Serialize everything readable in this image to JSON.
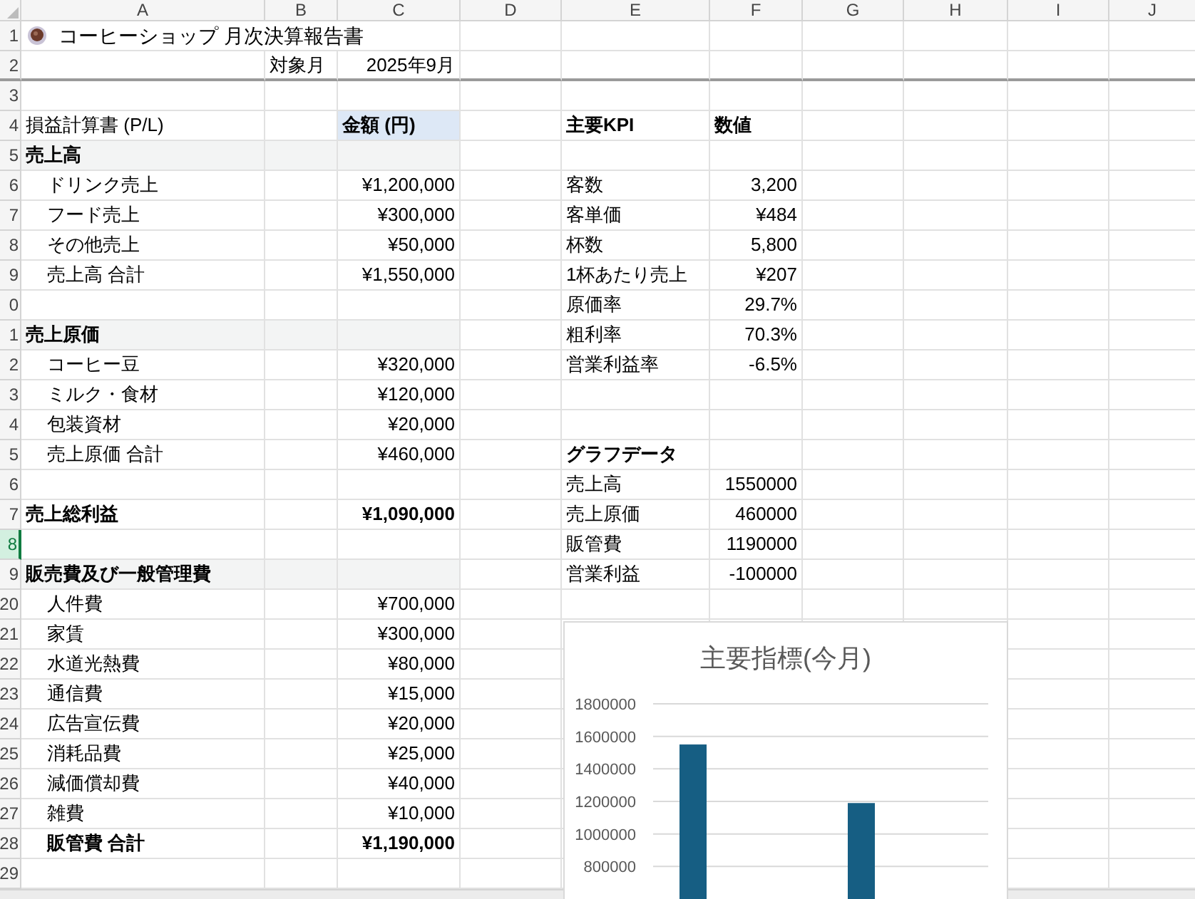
{
  "columns": [
    "A",
    "B",
    "C",
    "D",
    "E",
    "F",
    "G",
    "H",
    "I",
    "J"
  ],
  "rows": [
    {
      "number": "1",
      "selected": false,
      "section": false,
      "cells": {
        "a": {
          "text": "コーヒーショップ 月次決算報告書",
          "kind": "title",
          "bold": false,
          "highlighted": false
        }
      }
    },
    {
      "number": "2",
      "selected": false,
      "section": false,
      "cells": {
        "b": {
          "text": "対象月",
          "kind": "text",
          "bold": false,
          "highlighted": false
        },
        "c": {
          "text": "2025年9月",
          "kind": "number",
          "bold": false,
          "highlighted": false
        }
      }
    },
    {
      "number": "3",
      "selected": false,
      "section": false,
      "cells": {}
    },
    {
      "number": "4",
      "selected": false,
      "section": false,
      "cells": {
        "a": {
          "text": "損益計算書 (P/L)",
          "kind": "text",
          "bold": false,
          "highlighted": false
        },
        "c": {
          "text": "金額 (円)",
          "kind": "text",
          "bold": true,
          "highlighted": true
        },
        "e": {
          "text": "主要KPI",
          "kind": "text",
          "bold": true,
          "highlighted": false
        },
        "f": {
          "text": "数値",
          "kind": "text",
          "bold": true,
          "highlighted": false
        }
      }
    },
    {
      "number": "5",
      "selected": false,
      "section": true,
      "cells": {
        "a": {
          "text": "売上高",
          "kind": "text",
          "bold": true,
          "highlighted": false
        }
      }
    },
    {
      "number": "6",
      "selected": false,
      "section": false,
      "cells": {
        "a": {
          "text": "ドリンク売上",
          "kind": "indent",
          "bold": false,
          "highlighted": false
        },
        "c": {
          "text": "¥1,200,000",
          "kind": "number",
          "bold": false,
          "highlighted": false
        },
        "e": {
          "text": "客数",
          "kind": "text",
          "bold": false,
          "highlighted": false
        },
        "f": {
          "text": "3,200",
          "kind": "number",
          "bold": false,
          "highlighted": false
        }
      }
    },
    {
      "number": "7",
      "selected": false,
      "section": false,
      "cells": {
        "a": {
          "text": "フード売上",
          "kind": "indent",
          "bold": false,
          "highlighted": false
        },
        "c": {
          "text": "¥300,000",
          "kind": "number",
          "bold": false,
          "highlighted": false
        },
        "e": {
          "text": "客単価",
          "kind": "text",
          "bold": false,
          "highlighted": false
        },
        "f": {
          "text": "¥484",
          "kind": "number",
          "bold": false,
          "highlighted": false
        }
      }
    },
    {
      "number": "8",
      "selected": false,
      "section": false,
      "cells": {
        "a": {
          "text": "その他売上",
          "kind": "indent",
          "bold": false,
          "highlighted": false
        },
        "c": {
          "text": "¥50,000",
          "kind": "number",
          "bold": false,
          "highlighted": false
        },
        "e": {
          "text": "杯数",
          "kind": "text",
          "bold": false,
          "highlighted": false
        },
        "f": {
          "text": "5,800",
          "kind": "number",
          "bold": false,
          "highlighted": false
        }
      }
    },
    {
      "number": "9",
      "selected": false,
      "section": false,
      "cells": {
        "a": {
          "text": "売上高 合計",
          "kind": "indent",
          "bold": false,
          "highlighted": false
        },
        "c": {
          "text": "¥1,550,000",
          "kind": "number",
          "bold": false,
          "highlighted": false
        },
        "e": {
          "text": "1杯あたり売上",
          "kind": "text",
          "bold": false,
          "highlighted": false
        },
        "f": {
          "text": "¥207",
          "kind": "number",
          "bold": false,
          "highlighted": false
        }
      }
    },
    {
      "number": "0",
      "selected": false,
      "section": false,
      "cells": {
        "e": {
          "text": "原価率",
          "kind": "text",
          "bold": false,
          "highlighted": false
        },
        "f": {
          "text": "29.7%",
          "kind": "number",
          "bold": false,
          "highlighted": false
        }
      }
    },
    {
      "number": "1",
      "selected": false,
      "section": true,
      "cells": {
        "a": {
          "text": "売上原価",
          "kind": "text",
          "bold": true,
          "highlighted": false
        },
        "e": {
          "text": "粗利率",
          "kind": "text",
          "bold": false,
          "highlighted": false
        },
        "f": {
          "text": "70.3%",
          "kind": "number",
          "bold": false,
          "highlighted": false
        }
      }
    },
    {
      "number": "2",
      "selected": false,
      "section": false,
      "cells": {
        "a": {
          "text": "コーヒー豆",
          "kind": "indent",
          "bold": false,
          "highlighted": false
        },
        "c": {
          "text": "¥320,000",
          "kind": "number",
          "bold": false,
          "highlighted": false
        },
        "e": {
          "text": "営業利益率",
          "kind": "text",
          "bold": false,
          "highlighted": false
        },
        "f": {
          "text": "-6.5%",
          "kind": "number",
          "bold": false,
          "highlighted": false
        }
      }
    },
    {
      "number": "3",
      "selected": false,
      "section": false,
      "cells": {
        "a": {
          "text": "ミルク・食材",
          "kind": "indent",
          "bold": false,
          "highlighted": false
        },
        "c": {
          "text": "¥120,000",
          "kind": "number",
          "bold": false,
          "highlighted": false
        }
      }
    },
    {
      "number": "4",
      "selected": false,
      "section": false,
      "cells": {
        "a": {
          "text": "包装資材",
          "kind": "indent",
          "bold": false,
          "highlighted": false
        },
        "c": {
          "text": "¥20,000",
          "kind": "number",
          "bold": false,
          "highlighted": false
        }
      }
    },
    {
      "number": "5",
      "selected": false,
      "section": false,
      "cells": {
        "a": {
          "text": "売上原価 合計",
          "kind": "indent",
          "bold": false,
          "highlighted": false
        },
        "c": {
          "text": "¥460,000",
          "kind": "number",
          "bold": false,
          "highlighted": false
        },
        "e": {
          "text": "グラフデータ",
          "kind": "text",
          "bold": true,
          "highlighted": false
        }
      }
    },
    {
      "number": "6",
      "selected": false,
      "section": false,
      "cells": {
        "e": {
          "text": "売上高",
          "kind": "text",
          "bold": false,
          "highlighted": false
        },
        "f": {
          "text": "1550000",
          "kind": "number",
          "bold": false,
          "highlighted": false
        }
      }
    },
    {
      "number": "7",
      "selected": false,
      "section": false,
      "cells": {
        "a": {
          "text": "売上総利益",
          "kind": "text",
          "bold": true,
          "highlighted": false
        },
        "c": {
          "text": "¥1,090,000",
          "kind": "number",
          "bold": true,
          "highlighted": false
        },
        "e": {
          "text": "売上原価",
          "kind": "text",
          "bold": false,
          "highlighted": false
        },
        "f": {
          "text": "460000",
          "kind": "number",
          "bold": false,
          "highlighted": false
        }
      }
    },
    {
      "number": "8",
      "selected": true,
      "section": false,
      "cells": {
        "e": {
          "text": "販管費",
          "kind": "text",
          "bold": false,
          "highlighted": false
        },
        "f": {
          "text": "1190000",
          "kind": "number",
          "bold": false,
          "highlighted": false
        }
      }
    },
    {
      "number": "9",
      "selected": false,
      "section": true,
      "cells": {
        "a": {
          "text": "販売費及び一般管理費",
          "kind": "text",
          "bold": true,
          "highlighted": false
        },
        "e": {
          "text": "営業利益",
          "kind": "text",
          "bold": false,
          "highlighted": false
        },
        "f": {
          "text": "-100000",
          "kind": "number",
          "bold": false,
          "highlighted": false
        }
      }
    },
    {
      "number": "20",
      "selected": false,
      "section": false,
      "cells": {
        "a": {
          "text": "人件費",
          "kind": "indent",
          "bold": false,
          "highlighted": false
        },
        "c": {
          "text": "¥700,000",
          "kind": "number",
          "bold": false,
          "highlighted": false
        }
      }
    },
    {
      "number": "21",
      "selected": false,
      "section": false,
      "cells": {
        "a": {
          "text": "家賃",
          "kind": "indent",
          "bold": false,
          "highlighted": false
        },
        "c": {
          "text": "¥300,000",
          "kind": "number",
          "bold": false,
          "highlighted": false
        }
      }
    },
    {
      "number": "22",
      "selected": false,
      "section": false,
      "cells": {
        "a": {
          "text": "水道光熱費",
          "kind": "indent",
          "bold": false,
          "highlighted": false
        },
        "c": {
          "text": "¥80,000",
          "kind": "number",
          "bold": false,
          "highlighted": false
        }
      }
    },
    {
      "number": "23",
      "selected": false,
      "section": false,
      "cells": {
        "a": {
          "text": "通信費",
          "kind": "indent",
          "bold": false,
          "highlighted": false
        },
        "c": {
          "text": "¥15,000",
          "kind": "number",
          "bold": false,
          "highlighted": false
        }
      }
    },
    {
      "number": "24",
      "selected": false,
      "section": false,
      "cells": {
        "a": {
          "text": "広告宣伝費",
          "kind": "indent",
          "bold": false,
          "highlighted": false
        },
        "c": {
          "text": "¥20,000",
          "kind": "number",
          "bold": false,
          "highlighted": false
        }
      }
    },
    {
      "number": "25",
      "selected": false,
      "section": false,
      "cells": {
        "a": {
          "text": "消耗品費",
          "kind": "indent",
          "bold": false,
          "highlighted": false
        },
        "c": {
          "text": "¥25,000",
          "kind": "number",
          "bold": false,
          "highlighted": false
        }
      }
    },
    {
      "number": "26",
      "selected": false,
      "section": false,
      "cells": {
        "a": {
          "text": "減価償却費",
          "kind": "indent",
          "bold": false,
          "highlighted": false
        },
        "c": {
          "text": "¥40,000",
          "kind": "number",
          "bold": false,
          "highlighted": false
        }
      }
    },
    {
      "number": "27",
      "selected": false,
      "section": false,
      "cells": {
        "a": {
          "text": "雑費",
          "kind": "indent",
          "bold": false,
          "highlighted": false
        },
        "c": {
          "text": "¥10,000",
          "kind": "number",
          "bold": false,
          "highlighted": false
        }
      }
    },
    {
      "number": "28",
      "selected": false,
      "section": false,
      "cells": {
        "a": {
          "text": "販管費 合計",
          "kind": "indent",
          "bold": true,
          "highlighted": false
        },
        "c": {
          "text": "¥1,190,000",
          "kind": "number",
          "bold": true,
          "highlighted": false
        }
      }
    },
    {
      "number": "29",
      "selected": false,
      "section": false,
      "cells": {}
    }
  ],
  "chart": {
    "chart_data": {
      "type": "bar",
      "title": "主要指標(今月)",
      "series": [
        {
          "color": "#165e83",
          "values": [
            1550000,
            null,
            1190000,
            null
          ]
        }
      ],
      "ylim": [
        600000,
        1800000
      ],
      "grid": true,
      "yticks": [
        800000,
        1000000,
        1200000,
        1400000,
        1600000,
        1800000
      ]
    }
  }
}
